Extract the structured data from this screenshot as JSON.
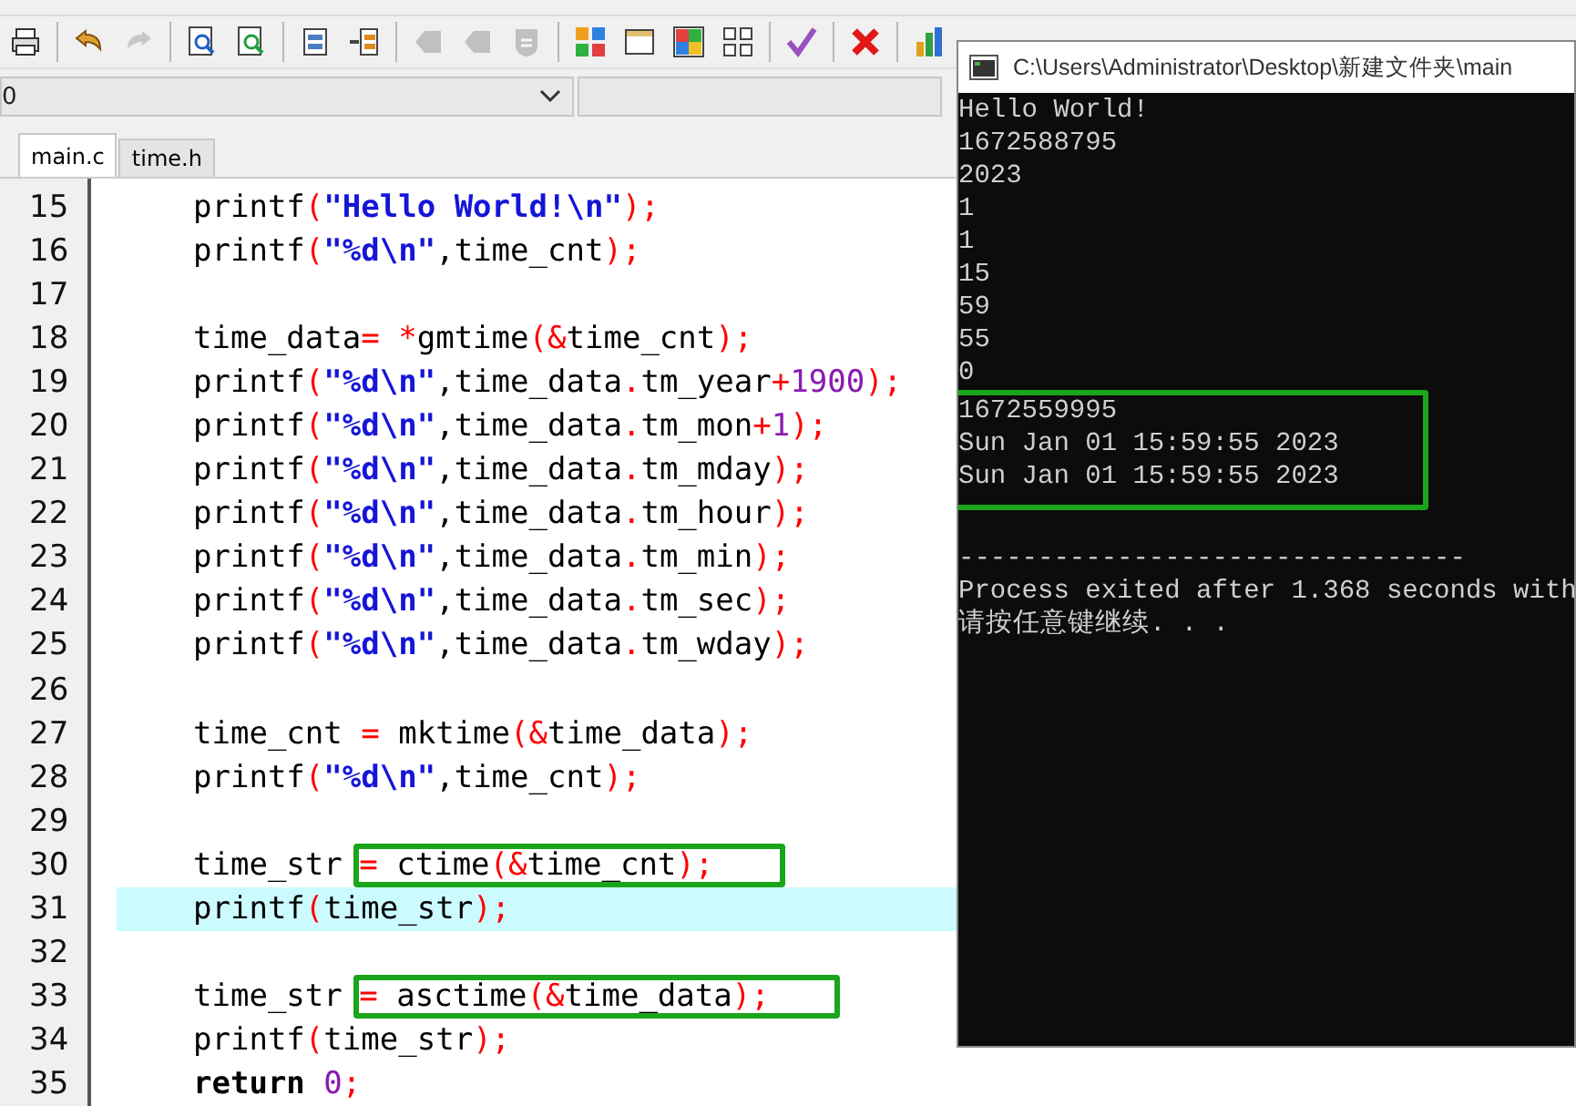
{
  "toolbar": {
    "items": [
      {
        "kind": "printer",
        "disabled": false
      },
      {
        "kind": "sep"
      },
      {
        "kind": "undo",
        "disabled": false
      },
      {
        "kind": "redo",
        "disabled": true
      },
      {
        "kind": "sep"
      },
      {
        "kind": "find",
        "disabled": false
      },
      {
        "kind": "replace",
        "disabled": false
      },
      {
        "kind": "sep"
      },
      {
        "kind": "indent",
        "disabled": false
      },
      {
        "kind": "unindent",
        "disabled": false
      },
      {
        "kind": "sep"
      },
      {
        "kind": "bookmark",
        "disabled": true
      },
      {
        "kind": "bookmark2",
        "disabled": true
      },
      {
        "kind": "shield",
        "disabled": true
      },
      {
        "kind": "sep"
      },
      {
        "kind": "grid",
        "disabled": false
      },
      {
        "kind": "window",
        "disabled": false
      },
      {
        "kind": "colors",
        "disabled": false
      },
      {
        "kind": "tiles",
        "disabled": false
      },
      {
        "kind": "sep"
      },
      {
        "kind": "check",
        "disabled": false
      },
      {
        "kind": "sep"
      },
      {
        "kind": "cross",
        "disabled": false
      },
      {
        "kind": "sep"
      },
      {
        "kind": "chart",
        "disabled": false
      }
    ]
  },
  "scope_combo": {
    "value": "0"
  },
  "tabs": [
    {
      "label": "main.c",
      "selected": true
    },
    {
      "label": "time.h",
      "selected": false
    }
  ],
  "editor": {
    "lines": [
      {
        "number": "15",
        "highlighted": false,
        "tokens": [
          {
            "kind": "plain",
            "text": "printf"
          },
          {
            "kind": "op",
            "text": "("
          },
          {
            "kind": "string",
            "text": "\"Hello World!\\n\""
          },
          {
            "kind": "op",
            "text": ");"
          }
        ]
      },
      {
        "number": "16",
        "highlighted": false,
        "tokens": [
          {
            "kind": "plain",
            "text": "printf"
          },
          {
            "kind": "op",
            "text": "("
          },
          {
            "kind": "string",
            "text": "\"%d\\n\""
          },
          {
            "kind": "plain",
            "text": ",time_cnt"
          },
          {
            "kind": "op",
            "text": ");"
          }
        ]
      },
      {
        "number": "17",
        "highlighted": false
      },
      {
        "number": "18",
        "highlighted": false,
        "tokens": [
          {
            "kind": "plain",
            "text": "time_data"
          },
          {
            "kind": "op",
            "text": "= *"
          },
          {
            "kind": "plain",
            "text": "gmtime"
          },
          {
            "kind": "op",
            "text": "(&"
          },
          {
            "kind": "plain",
            "text": "time_cnt"
          },
          {
            "kind": "op",
            "text": ");"
          }
        ]
      },
      {
        "number": "19",
        "highlighted": false,
        "tokens": [
          {
            "kind": "plain",
            "text": "printf"
          },
          {
            "kind": "op",
            "text": "("
          },
          {
            "kind": "string",
            "text": "\"%d\\n\""
          },
          {
            "kind": "plain",
            "text": ",time_data"
          },
          {
            "kind": "op",
            "text": "."
          },
          {
            "kind": "plain",
            "text": "tm_year"
          },
          {
            "kind": "op",
            "text": "+"
          },
          {
            "kind": "number",
            "text": "1900"
          },
          {
            "kind": "op",
            "text": ");"
          }
        ]
      },
      {
        "number": "20",
        "highlighted": false,
        "tokens": [
          {
            "kind": "plain",
            "text": "printf"
          },
          {
            "kind": "op",
            "text": "("
          },
          {
            "kind": "string",
            "text": "\"%d\\n\""
          },
          {
            "kind": "plain",
            "text": ",time_data"
          },
          {
            "kind": "op",
            "text": "."
          },
          {
            "kind": "plain",
            "text": "tm_mon"
          },
          {
            "kind": "op",
            "text": "+"
          },
          {
            "kind": "number",
            "text": "1"
          },
          {
            "kind": "op",
            "text": ");"
          }
        ]
      },
      {
        "number": "21",
        "highlighted": false,
        "tokens": [
          {
            "kind": "plain",
            "text": "printf"
          },
          {
            "kind": "op",
            "text": "("
          },
          {
            "kind": "string",
            "text": "\"%d\\n\""
          },
          {
            "kind": "plain",
            "text": ",time_data"
          },
          {
            "kind": "op",
            "text": "."
          },
          {
            "kind": "plain",
            "text": "tm_mday"
          },
          {
            "kind": "op",
            "text": ");"
          }
        ]
      },
      {
        "number": "22",
        "highlighted": false,
        "tokens": [
          {
            "kind": "plain",
            "text": "printf"
          },
          {
            "kind": "op",
            "text": "("
          },
          {
            "kind": "string",
            "text": "\"%d\\n\""
          },
          {
            "kind": "plain",
            "text": ",time_data"
          },
          {
            "kind": "op",
            "text": "."
          },
          {
            "kind": "plain",
            "text": "tm_hour"
          },
          {
            "kind": "op",
            "text": ");"
          }
        ]
      },
      {
        "number": "23",
        "highlighted": false,
        "tokens": [
          {
            "kind": "plain",
            "text": "printf"
          },
          {
            "kind": "op",
            "text": "("
          },
          {
            "kind": "string",
            "text": "\"%d\\n\""
          },
          {
            "kind": "plain",
            "text": ",time_data"
          },
          {
            "kind": "op",
            "text": "."
          },
          {
            "kind": "plain",
            "text": "tm_min"
          },
          {
            "kind": "op",
            "text": ");"
          }
        ]
      },
      {
        "number": "24",
        "highlighted": false,
        "tokens": [
          {
            "kind": "plain",
            "text": "printf"
          },
          {
            "kind": "op",
            "text": "("
          },
          {
            "kind": "string",
            "text": "\"%d\\n\""
          },
          {
            "kind": "plain",
            "text": ",time_data"
          },
          {
            "kind": "op",
            "text": "."
          },
          {
            "kind": "plain",
            "text": "tm_sec"
          },
          {
            "kind": "op",
            "text": ");"
          }
        ]
      },
      {
        "number": "25",
        "highlighted": false,
        "tokens": [
          {
            "kind": "plain",
            "text": "printf"
          },
          {
            "kind": "op",
            "text": "("
          },
          {
            "kind": "string",
            "text": "\"%d\\n\""
          },
          {
            "kind": "plain",
            "text": ",time_data"
          },
          {
            "kind": "op",
            "text": "."
          },
          {
            "kind": "plain",
            "text": "tm_wday"
          },
          {
            "kind": "op",
            "text": ");"
          }
        ]
      },
      {
        "number": "26",
        "highlighted": false
      },
      {
        "number": "27",
        "highlighted": false,
        "tokens": [
          {
            "kind": "plain",
            "text": "time_cnt "
          },
          {
            "kind": "op",
            "text": "="
          },
          {
            "kind": "plain",
            "text": " mktime"
          },
          {
            "kind": "op",
            "text": "(&"
          },
          {
            "kind": "plain",
            "text": "time_data"
          },
          {
            "kind": "op",
            "text": ");"
          }
        ]
      },
      {
        "number": "28",
        "highlighted": false,
        "tokens": [
          {
            "kind": "plain",
            "text": "printf"
          },
          {
            "kind": "op",
            "text": "("
          },
          {
            "kind": "string",
            "text": "\"%d\\n\""
          },
          {
            "kind": "plain",
            "text": ",time_cnt"
          },
          {
            "kind": "op",
            "text": ");"
          }
        ]
      },
      {
        "number": "29",
        "highlighted": false
      },
      {
        "number": "30",
        "highlighted": false,
        "tokens": [
          {
            "kind": "plain",
            "text": "time_str "
          }
        ],
        "framed": [
          {
            "kind": "op",
            "text": "="
          },
          {
            "kind": "plain",
            "text": " ctime"
          },
          {
            "kind": "op",
            "text": "(&"
          },
          {
            "kind": "plain",
            "text": "time_cnt"
          },
          {
            "kind": "op",
            "text": ");"
          }
        ]
      },
      {
        "number": "31",
        "highlighted": true,
        "tokens": [
          {
            "kind": "plain",
            "text": "printf"
          },
          {
            "kind": "op",
            "text": "("
          },
          {
            "kind": "plain",
            "text": "time_str"
          },
          {
            "kind": "op",
            "text": ");"
          }
        ]
      },
      {
        "number": "32",
        "highlighted": false
      },
      {
        "number": "33",
        "highlighted": false,
        "tokens": [
          {
            "kind": "plain",
            "text": "time_str "
          }
        ],
        "framed": [
          {
            "kind": "op",
            "text": "="
          },
          {
            "kind": "plain",
            "text": " asctime"
          },
          {
            "kind": "op",
            "text": "(&"
          },
          {
            "kind": "plain",
            "text": "time_data"
          },
          {
            "kind": "op",
            "text": ");"
          }
        ]
      },
      {
        "number": "34",
        "highlighted": false,
        "tokens": [
          {
            "kind": "plain",
            "text": "printf"
          },
          {
            "kind": "op",
            "text": "("
          },
          {
            "kind": "plain",
            "text": "time_str"
          },
          {
            "kind": "op",
            "text": ");"
          }
        ]
      },
      {
        "number": "35",
        "highlighted": false,
        "tokens": [
          {
            "kind": "keyword",
            "text": "return"
          },
          {
            "kind": "number",
            "text": " 0"
          },
          {
            "kind": "op",
            "text": ";"
          }
        ]
      }
    ]
  },
  "console": {
    "title": "C:\\Users\\Administrator\\Desktop\\新建文件夹\\main",
    "lines": [
      {
        "kind": "text",
        "text": "Hello World!",
        "framed": false
      },
      {
        "kind": "text",
        "text": "1672588795",
        "framed": false
      },
      {
        "kind": "text",
        "text": "2023",
        "framed": false
      },
      {
        "kind": "text",
        "text": "1",
        "framed": false
      },
      {
        "kind": "text",
        "text": "1",
        "framed": false
      },
      {
        "kind": "text",
        "text": "15",
        "framed": false
      },
      {
        "kind": "text",
        "text": "59",
        "framed": false
      },
      {
        "kind": "text",
        "text": "55",
        "framed": false
      },
      {
        "kind": "text",
        "text": "0",
        "framed": false
      },
      {
        "kind": "text",
        "text": "1672559995",
        "framed": true
      },
      {
        "kind": "text",
        "text": "Sun Jan 01 15:59:55 2023",
        "framed": true
      },
      {
        "kind": "text",
        "text": "Sun Jan 01 15:59:55 2023",
        "framed": true
      },
      {
        "kind": "gap",
        "framed": false
      },
      {
        "kind": "text",
        "text": "--------------------------------",
        "framed": false
      },
      {
        "kind": "text",
        "text": "Process exited after 1.368 seconds with",
        "framed": false
      },
      {
        "kind": "text",
        "text": "请按任意键继续. . .",
        "framed": false
      }
    ]
  }
}
